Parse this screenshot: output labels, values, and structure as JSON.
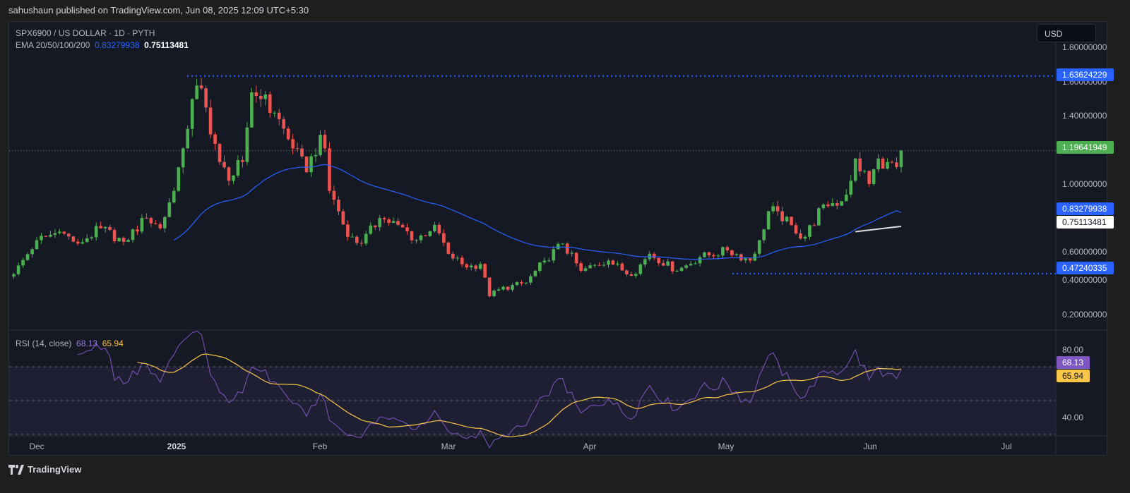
{
  "header": {
    "published": "sahushaun published on TradingView.com, Jun 08, 2025 12:09 UTC+5:30"
  },
  "legend": {
    "symbol": "SPX6900 / US DOLLAR · 1D · PYTH",
    "ema_label": "EMA 20/50/100/200",
    "ema50_value": "0.83279938",
    "ema200_value": "0.75113481"
  },
  "currency": "USD",
  "rsi_legend": {
    "label": "RSI (14, close)",
    "rsi_value": "68.13",
    "ma_value": "65.94"
  },
  "footer": {
    "brand": "TradingView"
  },
  "colors": {
    "up": "#4caf50",
    "down": "#ef5350",
    "ema50": "#2962ff",
    "ema200": "#e0e0e0",
    "rsi": "#7e57c2",
    "rsi_ma": "#f7c548",
    "accent": "#2962ff"
  },
  "chart_data": {
    "type": "candlestick",
    "title": "SPX6900 / US DOLLAR · 1D · PYTH",
    "start_date": "2024-11-26",
    "end_date": "2025-06-08",
    "close_keyframes": [
      [
        "2024-11-26",
        0.47
      ],
      [
        "2024-12-01",
        0.67
      ],
      [
        "2024-12-06",
        0.72
      ],
      [
        "2024-12-10",
        0.65
      ],
      [
        "2024-12-15",
        0.74
      ],
      [
        "2024-12-20",
        0.66
      ],
      [
        "2024-12-25",
        0.8
      ],
      [
        "2024-12-28",
        0.74
      ],
      [
        "2024-12-31",
        0.96
      ],
      [
        "2025-01-02",
        1.21
      ],
      [
        "2025-01-04",
        1.5
      ],
      [
        "2025-01-05",
        1.58
      ],
      [
        "2025-01-07",
        1.45
      ],
      [
        "2025-01-10",
        1.13
      ],
      [
        "2025-01-12",
        1.02
      ],
      [
        "2025-01-15",
        1.13
      ],
      [
        "2025-01-17",
        1.54
      ],
      [
        "2025-01-19",
        1.5
      ],
      [
        "2025-01-22",
        1.42
      ],
      [
        "2025-01-26",
        1.21
      ],
      [
        "2025-01-29",
        1.07
      ],
      [
        "2025-02-01",
        1.29
      ],
      [
        "2025-02-02",
        1.21
      ],
      [
        "2025-02-03",
        0.96
      ],
      [
        "2025-02-05",
        0.84
      ],
      [
        "2025-02-07",
        0.69
      ],
      [
        "2025-02-10",
        0.65
      ],
      [
        "2025-02-14",
        0.8
      ],
      [
        "2025-02-18",
        0.76
      ],
      [
        "2025-02-22",
        0.67
      ],
      [
        "2025-02-26",
        0.76
      ],
      [
        "2025-03-01",
        0.59
      ],
      [
        "2025-03-05",
        0.51
      ],
      [
        "2025-03-08",
        0.53
      ],
      [
        "2025-03-10",
        0.34
      ],
      [
        "2025-03-12",
        0.38
      ],
      [
        "2025-03-18",
        0.42
      ],
      [
        "2025-03-22",
        0.55
      ],
      [
        "2025-03-26",
        0.65
      ],
      [
        "2025-03-30",
        0.49
      ],
      [
        "2025-04-05",
        0.55
      ],
      [
        "2025-04-10",
        0.46
      ],
      [
        "2025-04-14",
        0.59
      ],
      [
        "2025-04-20",
        0.49
      ],
      [
        "2025-04-25",
        0.57
      ],
      [
        "2025-05-01",
        0.61
      ],
      [
        "2025-05-06",
        0.55
      ],
      [
        "2025-05-08",
        0.67
      ],
      [
        "2025-05-10",
        0.84
      ],
      [
        "2025-05-12",
        0.84
      ],
      [
        "2025-05-16",
        0.71
      ],
      [
        "2025-05-18",
        0.69
      ],
      [
        "2025-05-22",
        0.88
      ],
      [
        "2025-05-26",
        0.9
      ],
      [
        "2025-05-28",
        1.02
      ],
      [
        "2025-05-29",
        1.15
      ],
      [
        "2025-06-01",
        1.0
      ],
      [
        "2025-06-03",
        1.15
      ],
      [
        "2025-06-05",
        1.13
      ],
      [
        "2025-06-07",
        1.1
      ],
      [
        "2025-06-08",
        1.19641949
      ]
    ],
    "ema200_keyframes": [
      [
        "2025-05-29",
        0.72
      ],
      [
        "2025-06-08",
        0.75113481
      ]
    ],
    "price_axis": {
      "ticks": [
        "1.80000000",
        "1.60000000",
        "1.40000000",
        "1.00000000",
        "0.60000000",
        "0.40000000",
        "0.20000000"
      ],
      "range": [
        0.1,
        1.9
      ]
    },
    "price_tags": {
      "resistance": "1.63624229",
      "last": "1.19641949",
      "ema50": "0.83279938",
      "ema200": "0.75113481",
      "support": "0.47240335"
    },
    "levels": {
      "resistance": 1.63624229,
      "support": 0.47240335,
      "last": 1.19641949
    },
    "rsi_axis": {
      "ticks": [
        "80.00",
        "40.00"
      ],
      "bands": [
        70,
        50,
        30
      ]
    },
    "time_axis": [
      "Dec",
      "2025",
      "Feb",
      "Mar",
      "Apr",
      "May",
      "Jun",
      "Jul"
    ]
  }
}
